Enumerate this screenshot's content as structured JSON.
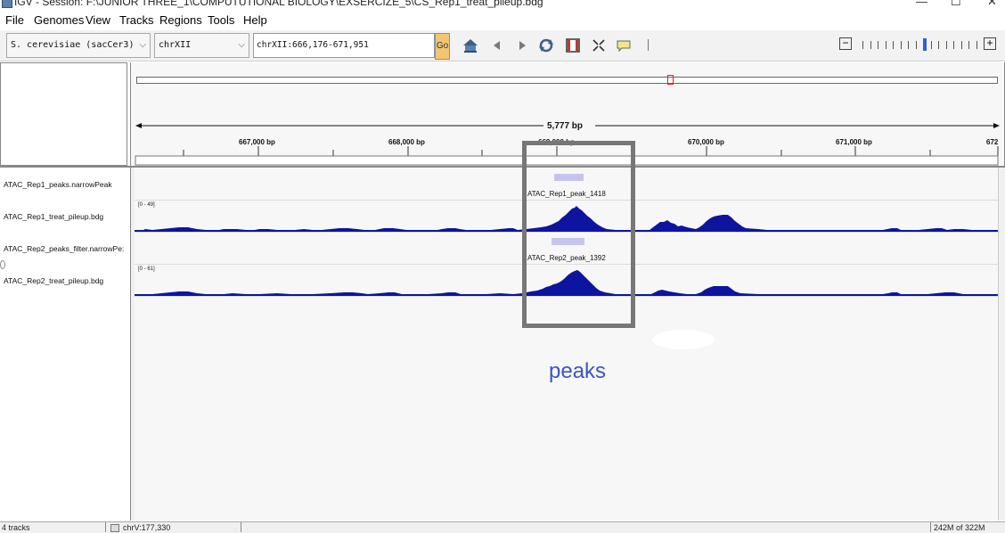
{
  "window": {
    "title": "IGV - Session: F:\\JUNIOR THREE_1\\COMPUTUTIONAL BIOLOGY\\EXSERCIZE_5\\CS_Rep1_treat_pileup.bdg",
    "minimize": "—",
    "maximize": "☐",
    "close": "✕"
  },
  "menu": [
    "File",
    "Genomes",
    "View",
    "Tracks",
    "Regions",
    "Tools",
    "Help"
  ],
  "toolbar": {
    "genome": "S. cerevisiae (sacCer3)",
    "chromosome": "chrXII",
    "locus": "chrXII:666,176-671,951",
    "go_label": "Go",
    "zoom_out": "−",
    "zoom_in": "+",
    "zoom_level_index": 8,
    "zoom_level_count": 16
  },
  "ruler": {
    "span_label": "5,777 bp",
    "ticks": [
      "667,000 bp",
      "668,000 bp",
      "669,000 bp",
      "670,000 bp",
      "671,000 bp",
      "672"
    ]
  },
  "tracks": [
    {
      "name": "ATAC_Rep1_peaks.narrowPeak",
      "type": "peak",
      "feature_label": "ATAC_Rep1_peak_1418"
    },
    {
      "name": "ATAC_Rep1_treat_pileup.bdg",
      "type": "signal",
      "range": "[0 - 49]"
    },
    {
      "name": "ATAC_Rep2_peaks_filter.narrowPe:",
      "type": "peak",
      "feature_label": "ATAC_Rep2_peak_1392"
    },
    {
      "name": "ATAC_Rep2_treat_pileup.bdg",
      "type": "signal",
      "range": "[0 - 61]"
    }
  ],
  "annotation": {
    "label": "peaks",
    "box_color": "#777777",
    "label_color": "#3a55c8"
  },
  "colors": {
    "signal": "#0d14a0",
    "peak_feature": "#c6c4ef",
    "viewport_marker": "#e02020"
  },
  "status": {
    "track_count": "4 tracks",
    "position": "chrV:177,330",
    "memory": "242M of 322M"
  }
}
